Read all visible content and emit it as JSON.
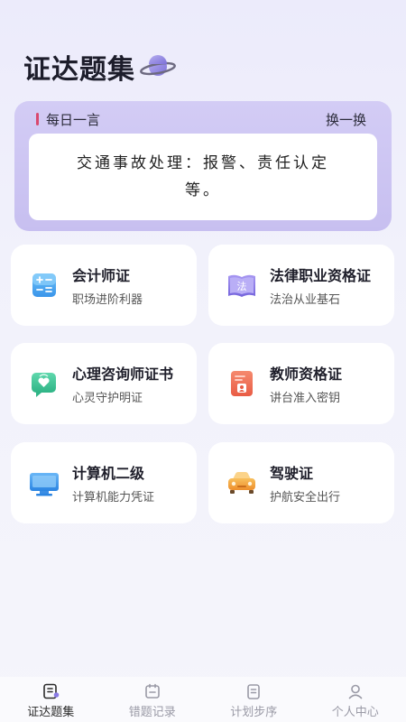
{
  "app": {
    "title": "证达题集"
  },
  "quote": {
    "heading": "每日一言",
    "refresh_label": "换一换",
    "text": "交通事故处理：报警、责任认定等。"
  },
  "categories": [
    {
      "name": "会计师证",
      "desc": "职场进阶利器",
      "icon": "calculator-icon"
    },
    {
      "name": "法律职业资格证",
      "desc": "法治从业基石",
      "icon": "law-book-icon",
      "icon_text": "法"
    },
    {
      "name": "心理咨询师证书",
      "desc": "心灵守护明证",
      "icon": "heart-chat-icon"
    },
    {
      "name": "教师资格证",
      "desc": "讲台准入密钥",
      "icon": "teacher-card-icon"
    },
    {
      "name": "计算机二级",
      "desc": "计算机能力凭证",
      "icon": "computer-icon"
    },
    {
      "name": "驾驶证",
      "desc": "护航安全出行",
      "icon": "car-icon"
    }
  ],
  "tabbar": {
    "tabs": [
      {
        "label": "证达题集",
        "icon": "book-icon",
        "active": true
      },
      {
        "label": "错题记录",
        "icon": "calendar-icon",
        "active": false
      },
      {
        "label": "计划步序",
        "icon": "clipboard-icon",
        "active": false
      },
      {
        "label": "个人中心",
        "icon": "user-icon",
        "active": false
      }
    ]
  },
  "colors": {
    "accent": "#c7bff0",
    "quote_bar": "#d9486e",
    "calculator": "#4aa8f0",
    "law": "#8a7ae6",
    "psych": "#3cc79a",
    "teacher": "#f0705a",
    "computer": "#2f8fe8",
    "car": "#f3a53c"
  }
}
